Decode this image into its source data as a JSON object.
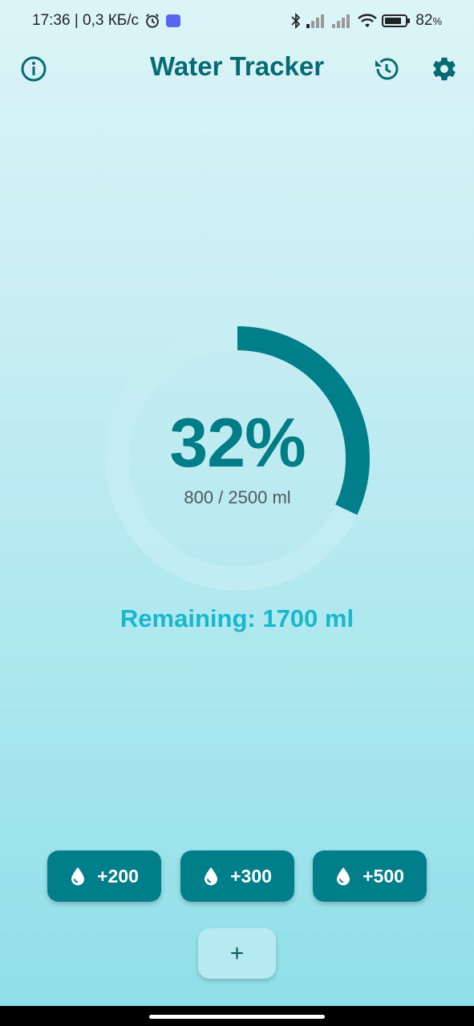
{
  "status_bar": {
    "time_net": "17:36 | 0,3 КБ/с",
    "battery": "82",
    "battery_unit": "%"
  },
  "app_bar": {
    "title": "Water Tracker",
    "icons": [
      "info-icon",
      "history-icon",
      "gear-icon"
    ]
  },
  "progress": {
    "percent_text": "32%",
    "fraction": 0.32,
    "amount_text": "800 / 2500 ml",
    "remaining_text": "Remaining: 1700 ml"
  },
  "quick_add": [
    {
      "label": "+200",
      "icon": "drop-icon"
    },
    {
      "label": "+300",
      "icon": "drop-icon"
    },
    {
      "label": "+500",
      "icon": "drop-icon"
    }
  ],
  "custom_add": {
    "label": "+"
  },
  "colors": {
    "primary": "#007f8a",
    "title": "#066b72",
    "remaining": "#18b8cc",
    "track": "#c6eef3"
  }
}
